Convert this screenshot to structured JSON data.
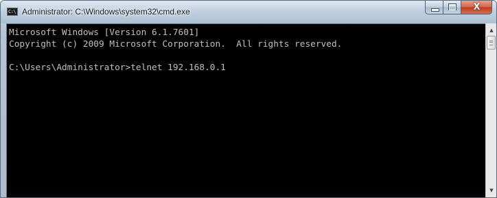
{
  "window": {
    "title": "Administrator: C:\\Windows\\system32\\cmd.exe",
    "icon_label": "C:\\"
  },
  "caption_buttons": {
    "minimize_icon": "minimize-icon",
    "maximize_icon": "maximize-icon",
    "close_label": "X"
  },
  "console": {
    "lines": [
      "Microsoft Windows [Version 6.1.7601]",
      "Copyright (c) 2009 Microsoft Corporation.  All rights reserved.",
      "",
      "C:\\Users\\Administrator>telnet 192.168.0.1"
    ],
    "background": "#000000",
    "foreground": "#c0c0c0"
  },
  "scrollbar": {
    "up_arrow": "▲",
    "down_arrow": "▼"
  }
}
